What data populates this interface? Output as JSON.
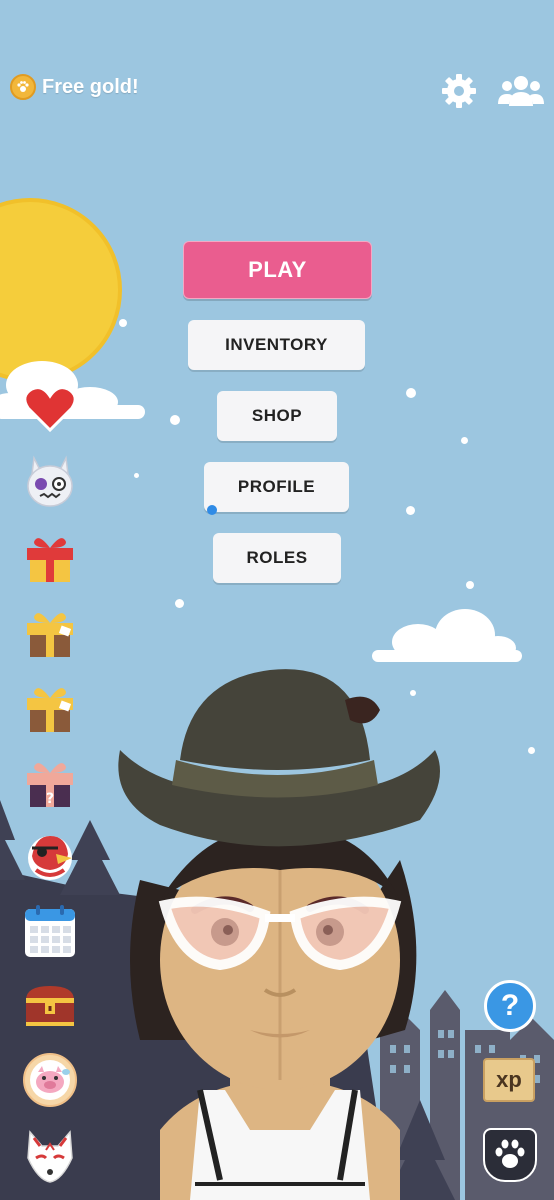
{
  "header": {
    "free_gold_label": "Free gold!",
    "coin_icon": "paw-coin-icon",
    "settings_icon": "gear-icon",
    "friends_icon": "friends-icon"
  },
  "menu": {
    "play_label": "PLAY",
    "inventory_label": "INVENTORY",
    "shop_label": "SHOP",
    "profile_label": "PROFILE",
    "roles_label": "ROLES"
  },
  "sidebar": {
    "items": [
      {
        "name": "heart-icon"
      },
      {
        "name": "bunny-mask-icon"
      },
      {
        "name": "red-gift-icon"
      },
      {
        "name": "gold-gift-icon"
      },
      {
        "name": "gold-gift-icon"
      },
      {
        "name": "mystery-gift-icon"
      },
      {
        "name": "pirate-bird-icon"
      },
      {
        "name": "calendar-icon"
      },
      {
        "name": "treasure-chest-icon"
      },
      {
        "name": "pig-badge-icon"
      },
      {
        "name": "fox-mask-icon"
      }
    ]
  },
  "corner": {
    "help_label": "?",
    "xp_label": "xp",
    "paw_icon": "paw-icon"
  },
  "colors": {
    "sky": "#9cc6e0",
    "sun": "#f5cd3b",
    "play": "#ea5d8f",
    "button": "#f5f5f7",
    "help": "#3a97e4",
    "mountain": "#3a3c4e"
  }
}
